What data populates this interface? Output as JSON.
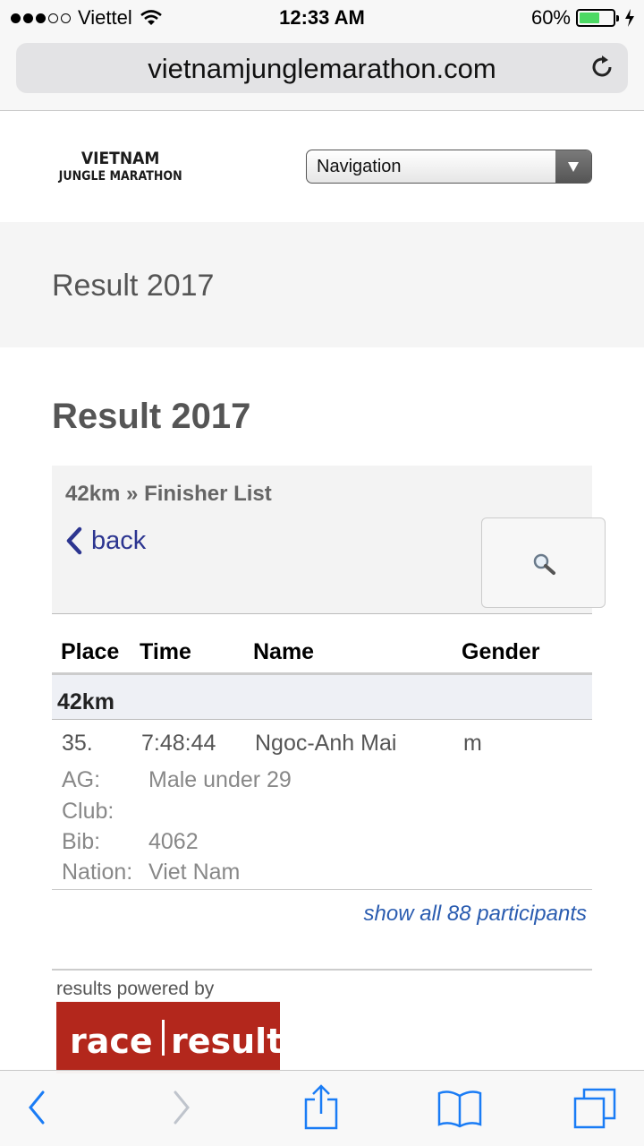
{
  "status_bar": {
    "carrier": "Viettel",
    "time": "12:33 AM",
    "battery_percent": "60%",
    "battery_level": 0.6,
    "signal_bars": 3,
    "icons": [
      "wifi-icon",
      "battery-icon",
      "charging-bolt-icon"
    ]
  },
  "browser": {
    "url": "vietnamjunglemarathon.com",
    "reload_icon": "reload-icon"
  },
  "site": {
    "logo_line1": "VIETNAM",
    "logo_line2": "JUNGLE MARATHON",
    "nav_select": "Navigation"
  },
  "banner": {
    "title": "Result 2017"
  },
  "main": {
    "title": "Result 2017",
    "breadcrumb": "42km » Finisher List",
    "back_label": "back",
    "search_icon": "magnifier-icon"
  },
  "table": {
    "headers": [
      "Place",
      "Time",
      "Name",
      "Gender"
    ],
    "group": "42km",
    "row": {
      "place": "35.",
      "time": "7:48:44",
      "name": "Ngoc-Anh Mai",
      "gender": "m",
      "details": [
        {
          "label": "AG:",
          "value": "Male under 29"
        },
        {
          "label": "Club:",
          "value": ""
        },
        {
          "label": "Bib:",
          "value": "4062"
        },
        {
          "label": "Nation:",
          "value": "Viet Nam"
        }
      ]
    },
    "show_all": "show all 88 participants"
  },
  "footer": {
    "powered_by": "results powered by",
    "logo_left": "race",
    "logo_right": "result"
  },
  "colors": {
    "link": "#2c3590",
    "accent_red": "#b3271c",
    "ios_blue": "#1a7cf5"
  }
}
